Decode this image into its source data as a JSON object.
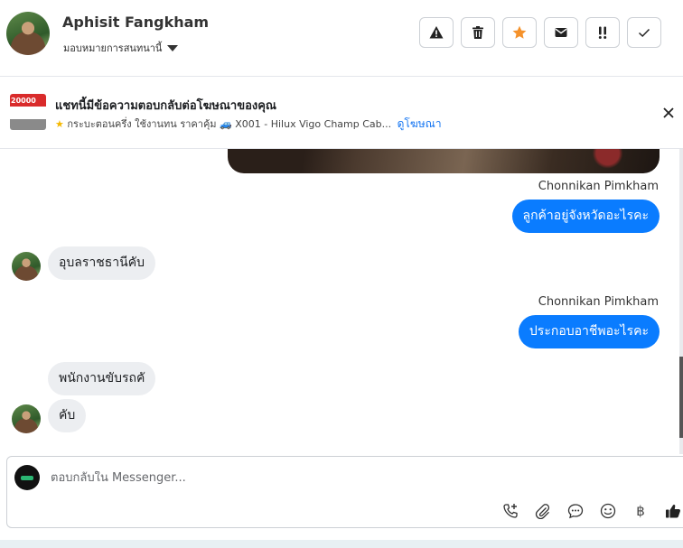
{
  "header": {
    "user_name": "Aphisit Fangkham",
    "assign_label": "มอบหมายการสนทนานี้",
    "actions": [
      {
        "name": "report-button",
        "icon": "warning-icon"
      },
      {
        "name": "delete-button",
        "icon": "trash-icon"
      },
      {
        "name": "star-button",
        "icon": "star-icon",
        "color": "#f5922b"
      },
      {
        "name": "mark-unread-button",
        "icon": "envelope-icon"
      },
      {
        "name": "follow-up-button",
        "icon": "exclamation-icon"
      },
      {
        "name": "done-button",
        "icon": "check-icon"
      }
    ]
  },
  "ad": {
    "thumb_price": "20000",
    "title": "แชทนี้มีข้อความตอบกลับต่อโฆษณาของคุณ",
    "subtitle": "กระบะตอนครึ่ง ใช้งานทน ราคาคุ้ม 🚙 X001 - Hilux Vigo Champ Cab...",
    "link": "ดูโฆษณา"
  },
  "messages": [
    {
      "type": "image",
      "from": "out"
    },
    {
      "type": "text",
      "from": "out",
      "sender": "Chonnikan Pimkham",
      "text": "ลูกค้าอยู่จังหวัดอะไรคะ"
    },
    {
      "type": "text",
      "from": "in",
      "text": "อุบลราชธานีคับ"
    },
    {
      "type": "text",
      "from": "out",
      "sender": "Chonnikan Pimkham",
      "text": "ประกอบอาชีพอะไรคะ"
    },
    {
      "type": "text",
      "from": "in",
      "text": "พนักงานขับรถคั"
    },
    {
      "type": "text",
      "from": "in",
      "text": "คับ"
    }
  ],
  "composer": {
    "placeholder": "ตอบกลับใน Messenger...",
    "tools": [
      "call-add-icon",
      "attach-icon",
      "saved-replies-icon",
      "emoji-icon",
      "baht-icon",
      "like-icon"
    ],
    "baht_symbol": "฿"
  },
  "colors": {
    "outgoing_bubble": "#0a7cff",
    "incoming_bubble": "#eceef1",
    "link": "#1877f2"
  }
}
